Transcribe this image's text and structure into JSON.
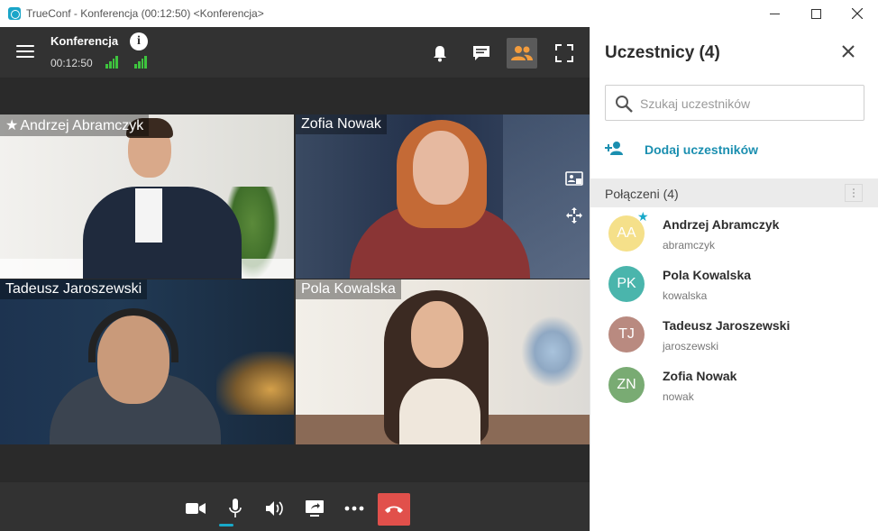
{
  "window": {
    "title": "TrueConf - Konferencja (00:12:50) <Konferencja>"
  },
  "conference": {
    "title": "Konferencja",
    "elapsed": "00:12:50",
    "signal_color": "#3ec43e"
  },
  "tiles": [
    {
      "name": "Andrzej Abramczyk",
      "owner": true
    },
    {
      "name": "Zofia Nowak",
      "owner": false
    },
    {
      "name": "Tadeusz Jaroszewski",
      "owner": false
    },
    {
      "name": "Pola Kowalska",
      "owner": false
    }
  ],
  "controls": {
    "camera_icon": "camera-icon",
    "mic_icon": "microphone-icon",
    "speaker_icon": "speaker-icon",
    "share_icon": "screen-share-icon",
    "more_icon": "more-icon",
    "hangup_icon": "hang-up-icon",
    "hangup_color": "#e1504b",
    "accent": "#18a9c9"
  },
  "panel": {
    "title": "Uczestnicy (4)",
    "search_placeholder": "Szukaj uczestników",
    "add_label": "Dodaj uczestników",
    "section_label": "Połączeni (4)",
    "participants": [
      {
        "initials": "AA",
        "name": "Andrzej Abramczyk",
        "login": "abramczyk",
        "color": "#f5e08a",
        "owner": true
      },
      {
        "initials": "PK",
        "name": "Pola Kowalska",
        "login": "kowalska",
        "color": "#4ab5ac",
        "owner": false
      },
      {
        "initials": "TJ",
        "name": "Tadeusz Jaroszewski",
        "login": "jaroszewski",
        "color": "#b98a80",
        "owner": false
      },
      {
        "initials": "ZN",
        "name": "Zofia Nowak",
        "login": "nowak",
        "color": "#79ab73",
        "owner": false
      }
    ]
  }
}
